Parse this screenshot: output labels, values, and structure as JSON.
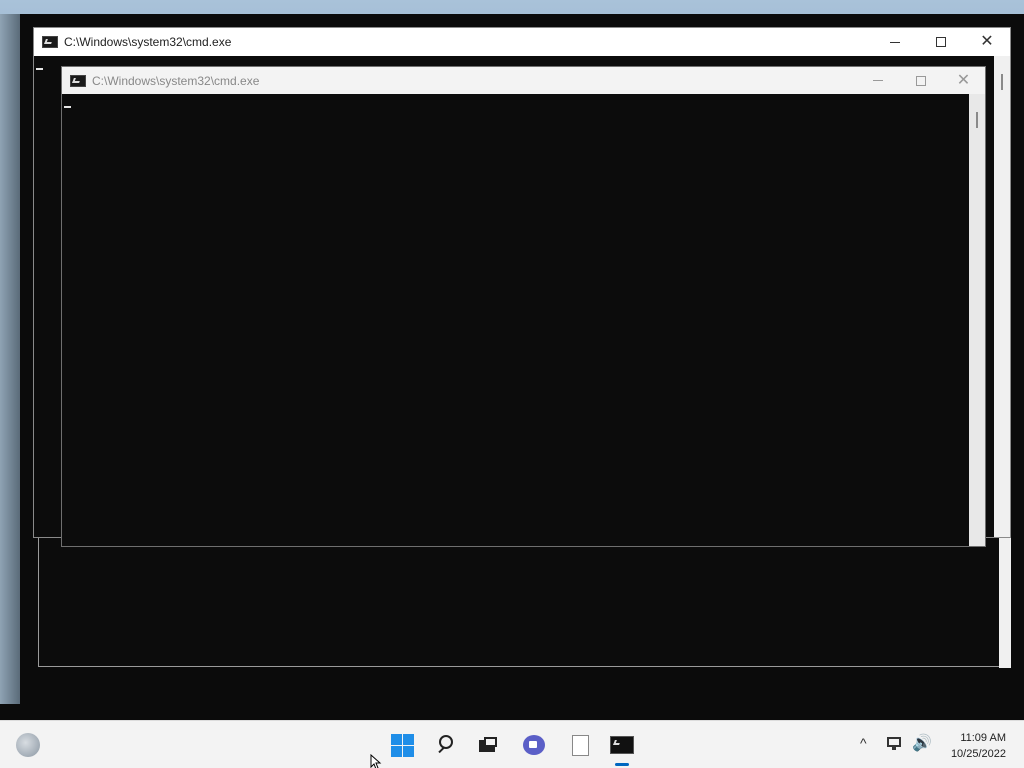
{
  "windows": {
    "outer": {
      "title": "C:\\Windows\\system32\\cmd.exe",
      "icon": "cmd-icon"
    },
    "inner": {
      "title": "C:\\Windows\\system32\\cmd.exe",
      "icon": "cmd-icon"
    }
  },
  "controls": {
    "close_glyph": "✕"
  },
  "taskbar": {
    "apps": [
      {
        "name": "widgets",
        "icon": "widgets-icon"
      },
      {
        "name": "start",
        "icon": "windows-start-icon"
      },
      {
        "name": "search",
        "icon": "search-icon"
      },
      {
        "name": "task-view",
        "icon": "task-view-icon"
      },
      {
        "name": "chat",
        "icon": "teams-chat-icon"
      },
      {
        "name": "file",
        "icon": "document-icon"
      },
      {
        "name": "command-prompt",
        "icon": "cmd-icon",
        "active": true
      }
    ],
    "tray": {
      "chevron_glyph": "^",
      "volume_glyph": "🔊"
    },
    "clock": {
      "time": "11:09 AM",
      "date": "10/25/2022"
    },
    "accent_color": "#0067c0"
  }
}
